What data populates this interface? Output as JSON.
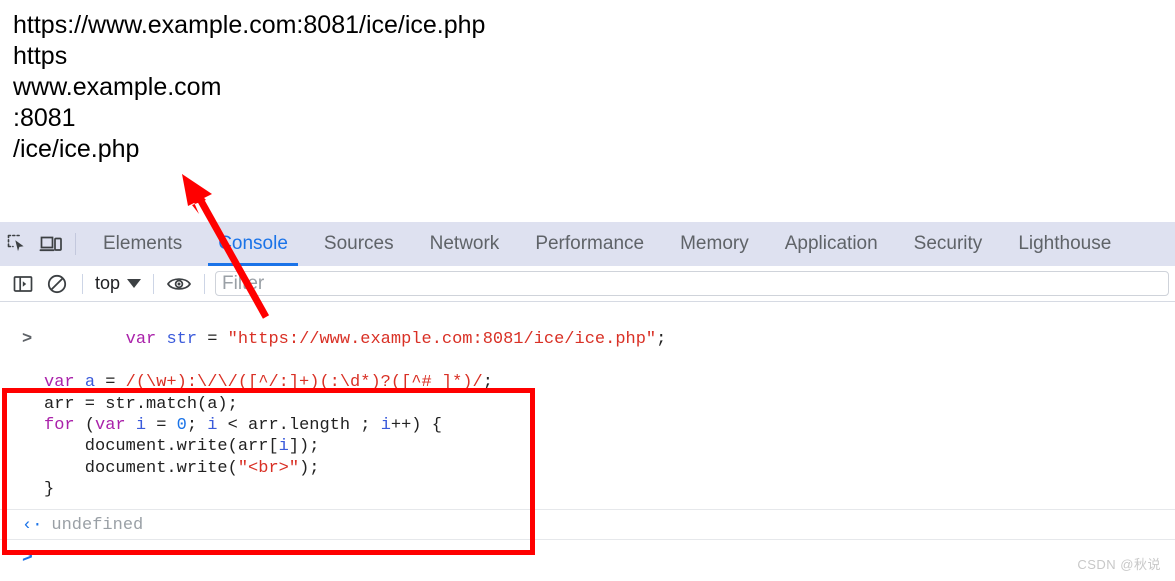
{
  "page_output": {
    "lines": [
      "https://www.example.com:8081/ice/ice.php",
      "https",
      "www.example.com",
      ":8081",
      "/ice/ice.php"
    ]
  },
  "devtools": {
    "icons": {
      "inspect": "inspect-element-icon",
      "device": "device-toolbar-icon"
    },
    "tabs": [
      {
        "label": "Elements",
        "active": false
      },
      {
        "label": "Console",
        "active": true
      },
      {
        "label": "Sources",
        "active": false
      },
      {
        "label": "Network",
        "active": false
      },
      {
        "label": "Performance",
        "active": false
      },
      {
        "label": "Memory",
        "active": false
      },
      {
        "label": "Application",
        "active": false
      },
      {
        "label": "Security",
        "active": false
      },
      {
        "label": "Lighthouse",
        "active": false
      }
    ],
    "toolbar": {
      "sidebar_toggle": "console-sidebar-icon",
      "clear_console": "clear-console-icon",
      "context_value": "top",
      "eye_icon": "live-expression-eye-icon",
      "filter_placeholder": "Filter",
      "filter_value": ""
    },
    "console": {
      "prompt_caret": ">",
      "input_lines": [
        [
          {
            "t": "var ",
            "c": "kw"
          },
          {
            "t": "str",
            "c": "var"
          },
          {
            "t": " = ",
            "c": "plain"
          },
          {
            "t": "\"https://www.example.com:8081/ice/ice.php\"",
            "c": "str"
          },
          {
            "t": ";",
            "c": "plain"
          }
        ],
        [
          {
            "t": "var ",
            "c": "kw"
          },
          {
            "t": "a",
            "c": "var"
          },
          {
            "t": " = ",
            "c": "plain"
          },
          {
            "t": "/(\\w+):\\/\\/([^/:]+)(:\\d*)?([^# ]*)/",
            "c": "rx"
          },
          {
            "t": ";",
            "c": "plain"
          }
        ],
        [
          {
            "t": "arr",
            "c": "plain"
          },
          {
            "t": " = ",
            "c": "plain"
          },
          {
            "t": "str.match(a);",
            "c": "plain"
          }
        ],
        [
          {
            "t": "for ",
            "c": "kw"
          },
          {
            "t": "(",
            "c": "plain"
          },
          {
            "t": "var ",
            "c": "kw"
          },
          {
            "t": "i",
            "c": "var"
          },
          {
            "t": " = ",
            "c": "plain"
          },
          {
            "t": "0",
            "c": "num"
          },
          {
            "t": "; ",
            "c": "plain"
          },
          {
            "t": "i",
            "c": "var"
          },
          {
            "t": " < arr.length ; ",
            "c": "plain"
          },
          {
            "t": "i",
            "c": "var"
          },
          {
            "t": "++) {",
            "c": "plain"
          }
        ],
        [
          {
            "t": "    document.write(arr[",
            "c": "plain"
          },
          {
            "t": "i",
            "c": "var"
          },
          {
            "t": "]);",
            "c": "plain"
          }
        ],
        [
          {
            "t": "    document.write(",
            "c": "plain"
          },
          {
            "t": "\"<br>\"",
            "c": "str"
          },
          {
            "t": ");",
            "c": "plain"
          }
        ],
        [
          {
            "t": "}",
            "c": "plain"
          }
        ]
      ],
      "result_arrow": "‹·",
      "result_value": "undefined",
      "next_prompt_caret": ">"
    }
  },
  "annotations": {
    "red_box_color": "#ff0000",
    "red_arrow_color": "#ff0000"
  },
  "watermark": {
    "text": "CSDN @秋说"
  },
  "colors": {
    "tabstrip_bg": "#dee1f0",
    "active_tab": "#1a73e8",
    "inactive_tab": "#5f6368",
    "string": "#d93025",
    "keyword": "#aa22aa",
    "number": "#1a73e8",
    "result_gray": "#9aa0a6"
  }
}
